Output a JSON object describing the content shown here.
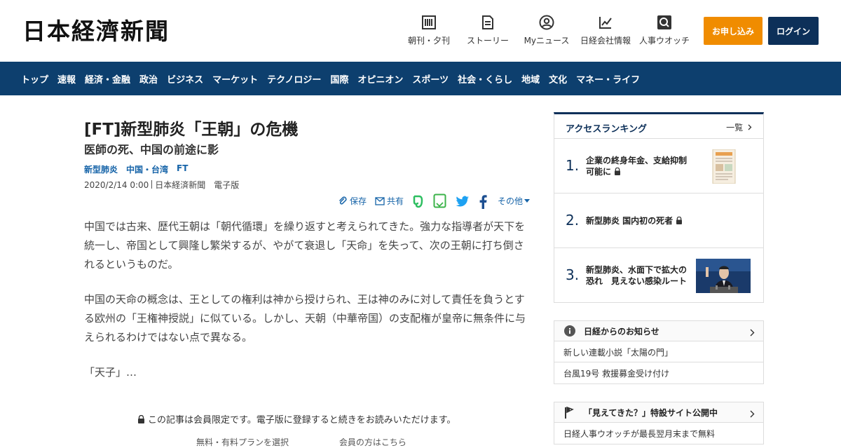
{
  "header": {
    "logo": "日本経濟新聞",
    "nav": [
      {
        "label": "朝刊・夕刊",
        "icon": "newspaper-icon"
      },
      {
        "label": "ストーリー",
        "icon": "story-icon"
      },
      {
        "label": "Myニュース",
        "icon": "user-icon"
      },
      {
        "label": "日経会社情報",
        "icon": "chart-icon"
      },
      {
        "label": "人事ウオッチ",
        "icon": "search-person-icon"
      }
    ],
    "subscribe": "お申し込み",
    "login": "ログイン"
  },
  "global_nav": {
    "items": [
      "トップ",
      "速報",
      "経済・金融",
      "政治",
      "ビジネス",
      "マーケット",
      "テクノロジー",
      "国際",
      "オピニオン",
      "スポーツ",
      "社会・くらし",
      "地域",
      "文化",
      "マネー・ライフ"
    ]
  },
  "article": {
    "title": "[FT]新型肺炎「王朝」の危機",
    "subtitle": "医師の死、中国の前途に影",
    "tags": [
      "新型肺炎",
      "中国・台湾",
      "FT"
    ],
    "date": "2020/2/14 0:00",
    "source": "日本経済新聞　電子版",
    "share": {
      "save": "保存",
      "share": "共有",
      "more": "その他"
    },
    "paragraphs": [
      "中国では古来、歴代王朝は「朝代循環」を繰り返すと考えられてきた。強力な指導者が天下を統一し、帝国として興隆し繁栄するが、やがて衰退し「天命」を失って、次の王朝に打ち倒されるというものだ。",
      "中国の天命の概念は、王としての権利は神から授けられ、王は神のみに対して責任を負うとする欧州の「王権神授説」に似ている。しかし、天朝（中華帝国）の支配権が皇帝に無条件に与えられるわけではない点で異なる。",
      "「天子」…"
    ],
    "paywall": "この記事は会員限定です。電子版に登録すると続きをお読みいただけます。",
    "paywall_links": [
      "無料・有料プランを選択",
      "会員の方はこちら"
    ]
  },
  "ranking": {
    "title": "アクセスランキング",
    "more": "一覧",
    "items": [
      {
        "rank": "1.",
        "text": "企業の終身年金、支給抑制可能に",
        "locked": true
      },
      {
        "rank": "2.",
        "text": "新型肺炎 国内初の死者",
        "locked": true
      },
      {
        "rank": "3.",
        "text": "新型肺炎、水面下で拡大の恐れ　見えない感染ルート",
        "locked": false
      }
    ]
  },
  "notice": {
    "title": "日経からのお知らせ",
    "items": [
      "新しい連載小説「太陽の門」",
      "台風19号 救援募金受け付け"
    ]
  },
  "promo": {
    "title": "「見えてきた？」特設サイト公開中",
    "items": [
      "日経人事ウオッチが最長翌月末まで無料"
    ]
  },
  "colors": {
    "navy": "#0d3f6e",
    "orange": "#f08c00",
    "link": "#1563a8"
  }
}
